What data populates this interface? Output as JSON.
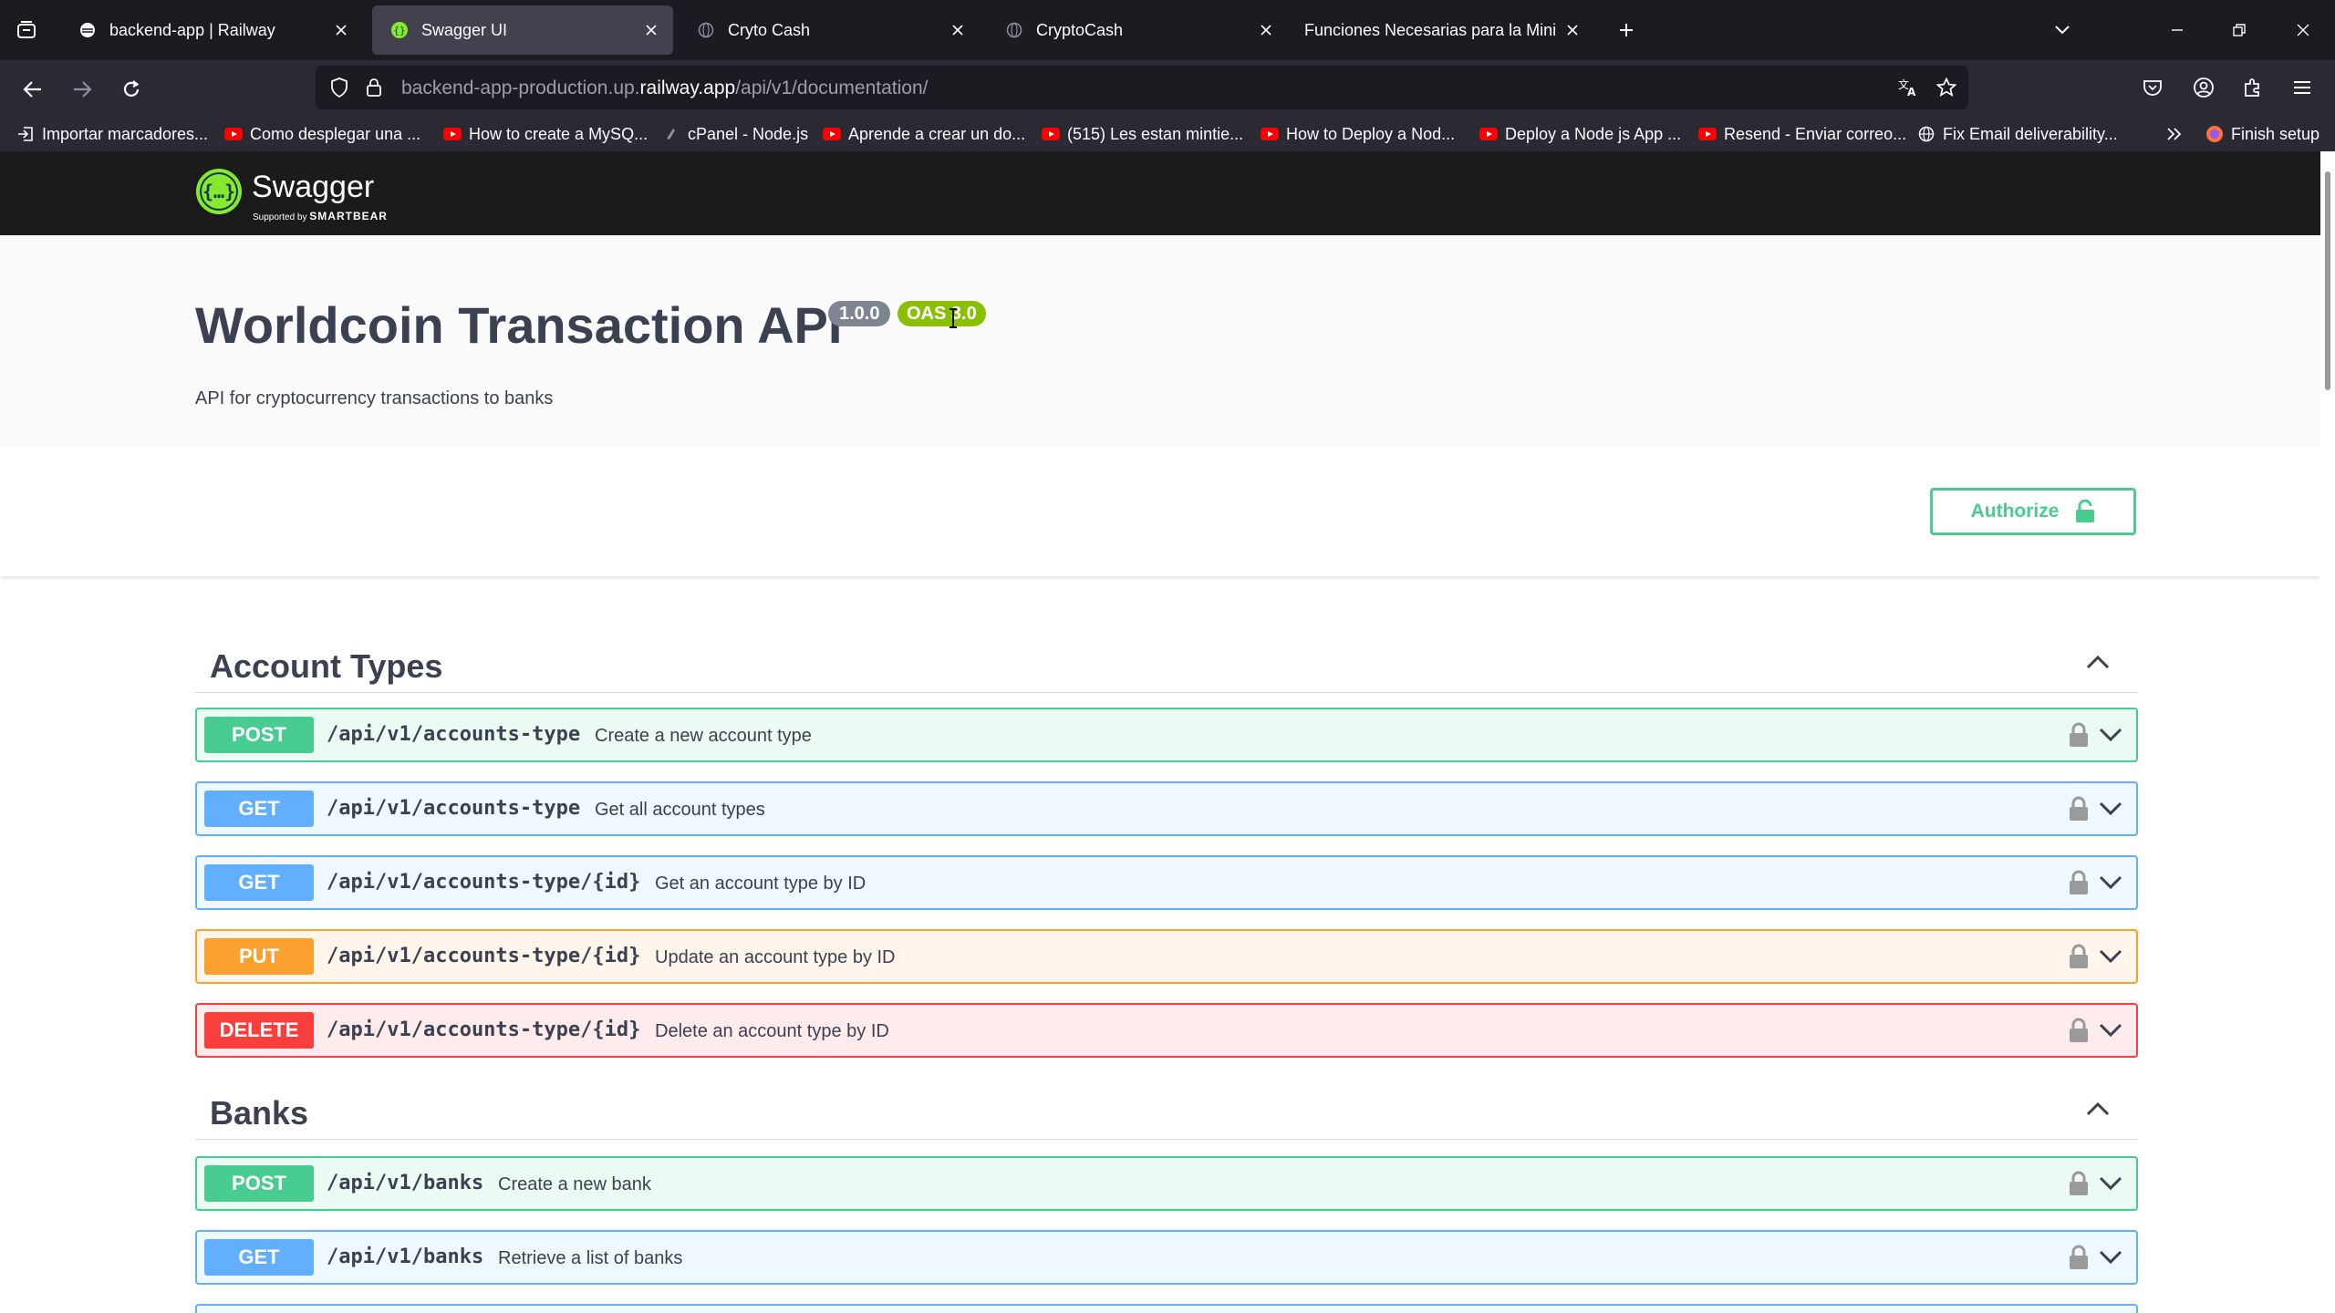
{
  "browser": {
    "tabs": [
      {
        "title": "backend-app | Railway",
        "active": false,
        "icon": "railway-icon"
      },
      {
        "title": "Swagger UI",
        "active": true,
        "icon": "swagger-icon"
      },
      {
        "title": "Cryto Cash",
        "active": false,
        "icon": "globe-icon"
      },
      {
        "title": "CryptoCash",
        "active": false,
        "icon": "globe-icon"
      },
      {
        "title": "Funciones Necesarias para la Mini A",
        "active": false,
        "icon": "none"
      }
    ],
    "url": {
      "prefix": "backend-app-production.up.",
      "host": "railway.app",
      "path": "/api/v1/documentation/"
    },
    "bookmarks": [
      {
        "label": "Importar marcadores...",
        "icon": "import-icon"
      },
      {
        "label": "Como desplegar una ...",
        "icon": "youtube-icon"
      },
      {
        "label": "How to create a MySQ...",
        "icon": "youtube-icon"
      },
      {
        "label": "cPanel - Node.js",
        "icon": "cpanel-icon"
      },
      {
        "label": "Aprende a crear un do...",
        "icon": "youtube-icon"
      },
      {
        "label": "(515) Les estan mintie...",
        "icon": "youtube-icon"
      },
      {
        "label": "How to Deploy a Nod...",
        "icon": "youtube-icon"
      },
      {
        "label": "Deploy a Node js App ...",
        "icon": "youtube-icon"
      },
      {
        "label": "Resend - Enviar correo...",
        "icon": "youtube-icon"
      },
      {
        "label": "Fix Email deliverability...",
        "icon": "globe-icon"
      },
      {
        "label": "Finish setup",
        "icon": "firefox-icon"
      }
    ]
  },
  "swagger": {
    "brand": "Swagger",
    "brand_sub_prefix": "Supported by",
    "brand_sub_name": "SMARTBEAR",
    "info": {
      "title": "Worldcoin Transaction API",
      "version": "1.0.0",
      "oas": "OAS 3.0",
      "description": "API for cryptocurrency transactions to banks"
    },
    "authorize_label": "Authorize",
    "sections": [
      {
        "name": "Account Types",
        "operations": [
          {
            "method": "POST",
            "path": "/api/v1/accounts-type",
            "summary": "Create a new account type"
          },
          {
            "method": "GET",
            "path": "/api/v1/accounts-type",
            "summary": "Get all account types"
          },
          {
            "method": "GET",
            "path": "/api/v1/accounts-type/{id}",
            "summary": "Get an account type by ID"
          },
          {
            "method": "PUT",
            "path": "/api/v1/accounts-type/{id}",
            "summary": "Update an account type by ID"
          },
          {
            "method": "DELETE",
            "path": "/api/v1/accounts-type/{id}",
            "summary": "Delete an account type by ID"
          }
        ]
      },
      {
        "name": "Banks",
        "operations": [
          {
            "method": "POST",
            "path": "/api/v1/banks",
            "summary": "Create a new bank"
          },
          {
            "method": "GET",
            "path": "/api/v1/banks",
            "summary": "Retrieve a list of banks"
          }
        ]
      }
    ]
  },
  "colors": {
    "post": "#49cc90",
    "get": "#61affe",
    "put": "#fca130",
    "delete": "#f93e3e",
    "swagger_green": "#85ea2d",
    "topbar": "#1b1b1b"
  }
}
